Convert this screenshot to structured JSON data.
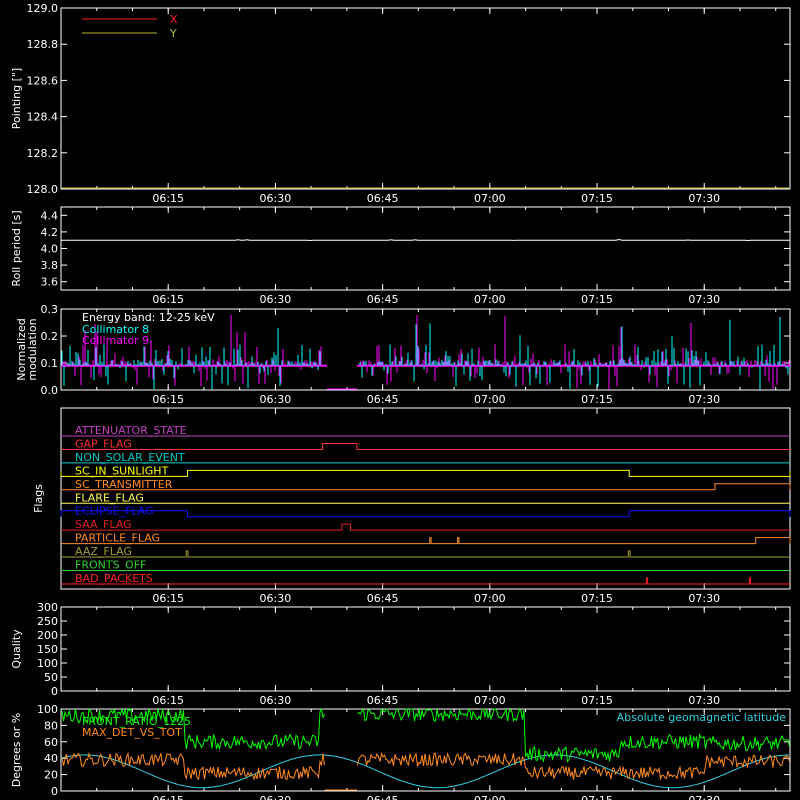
{
  "chart_data": [
    {
      "type": "line",
      "ylabel": "Pointing [\"]",
      "ylim": [
        128.0,
        129.0
      ],
      "yticks": [
        "128.0",
        "128.2",
        "128.4",
        "128.6",
        "128.8",
        "129.0"
      ],
      "xticks": [
        "06:15",
        "06:30",
        "06:45",
        "07:00",
        "07:15",
        "07:30"
      ],
      "legend": [
        {
          "name": "X",
          "color": "#ff2020"
        },
        {
          "name": "Y",
          "color": "#b8b830"
        }
      ],
      "series": [
        {
          "name": "X",
          "color": "#ff2020",
          "x": [
            6.0,
            7.7
          ],
          "y": [
            128.0,
            128.0
          ]
        },
        {
          "name": "Y",
          "color": "#b8b830",
          "x": [
            6.0,
            7.7
          ],
          "y": [
            128.0,
            128.0
          ]
        }
      ]
    },
    {
      "type": "line",
      "ylabel": "Roll period [s]",
      "ylim": [
        3.5,
        4.5
      ],
      "yticks": [
        "3.6",
        "3.8",
        "4.0",
        "4.2",
        "4.4"
      ],
      "xticks": [
        "06:15",
        "06:30",
        "06:45",
        "07:00",
        "07:15",
        "07:30"
      ],
      "series": [
        {
          "color": "#ffffff",
          "x": [
            6.0,
            7.7
          ],
          "y": [
            4.1,
            4.1
          ]
        }
      ]
    },
    {
      "type": "line",
      "ylabel": "Normalized modulation",
      "ylim": [
        0,
        0.3
      ],
      "yticks": [
        "0.0",
        "0.1",
        "0.2",
        "0.3"
      ],
      "xticks": [
        "06:15",
        "06:30",
        "06:45",
        "07:00",
        "07:15",
        "07:30"
      ],
      "annotation": "Energy band: 12-25 keV",
      "legend": [
        {
          "name": "Collimator 8",
          "color": "#00ffff"
        },
        {
          "name": "Collimator 9",
          "color": "#ff00ff"
        }
      ],
      "baseline": 0.09,
      "gap": [
        6.62,
        6.69
      ]
    },
    {
      "type": "line",
      "ylabel": "Flags",
      "xticks": [
        "06:15",
        "06:30",
        "06:45",
        "07:00",
        "07:15",
        "07:30"
      ],
      "flags": [
        {
          "name": "ATTENUATOR_STATE",
          "color": "#c040c0",
          "segments": []
        },
        {
          "name": "GAP_FLAG",
          "color": "#ff3030",
          "segments": [
            [
              6.61,
              6.69
            ]
          ]
        },
        {
          "name": "NON_SOLAR_EVENT",
          "color": "#00c8c8",
          "segments": []
        },
        {
          "name": "SC_IN_SUNLIGHT",
          "color": "#ffff00",
          "low_segments": [
            [
              6.0,
              6.295
            ],
            [
              7.325,
              7.7
            ]
          ]
        },
        {
          "name": "SC_TRANSMITTER",
          "color": "#ff8c28",
          "segments": [
            [
              7.525,
              7.7
            ]
          ]
        },
        {
          "name": "FLARE_FLAG",
          "color": "#ffff50",
          "segments": []
        },
        {
          "name": "ECLIPSE_FLAG",
          "color": "#1010ff",
          "segments": [
            [
              6.0,
              6.295
            ],
            [
              7.325,
              7.7
            ]
          ]
        },
        {
          "name": "SAA_FLAG",
          "color": "#e02020",
          "segments": [
            [
              6.655,
              6.675
            ]
          ]
        },
        {
          "name": "PARTICLE_FLAG",
          "color": "#ff8c28",
          "segments": [
            [
              6.86,
              6.863
            ],
            [
              6.925,
              6.928
            ],
            [
              7.62,
              7.7
            ]
          ]
        },
        {
          "name": "AAZ_FLAG",
          "color": "#a0a030",
          "segments": [
            [
              6.292,
              6.296
            ],
            [
              7.323,
              7.327
            ]
          ]
        },
        {
          "name": "FRONTS_OFF",
          "color": "#30d030",
          "segments": []
        },
        {
          "name": "BAD_PACKETS",
          "color": "#ff2020",
          "segments": [
            [
              7.365,
              7.368
            ],
            [
              7.605,
              7.608
            ]
          ]
        }
      ]
    },
    {
      "type": "line",
      "ylabel": "Quality",
      "ylim": [
        0,
        300
      ],
      "yticks": [
        "0",
        "50",
        "100",
        "150",
        "200",
        "250",
        "300"
      ],
      "xticks": [
        "06:15",
        "06:30",
        "06:45",
        "07:00",
        "07:15",
        "07:30"
      ],
      "series": []
    },
    {
      "type": "line",
      "ylabel": "Degrees or %",
      "ylim": [
        0,
        100
      ],
      "yticks": [
        "0",
        "20",
        "40",
        "60",
        "80",
        "100"
      ],
      "xticks": [
        "06:15",
        "06:30",
        "06:45",
        "07:00",
        "07:15",
        "07:30"
      ],
      "legend": [
        {
          "name": "FRONT_RATIO_1225",
          "color": "#00ff00"
        },
        {
          "name": "MAX_DET_VS_TOT",
          "color": "#ff8c1e"
        }
      ],
      "right_label": {
        "name": "Absolute geomagnetic latitude",
        "color": "#30d0e0"
      },
      "gap": [
        6.615,
        6.69
      ]
    }
  ]
}
